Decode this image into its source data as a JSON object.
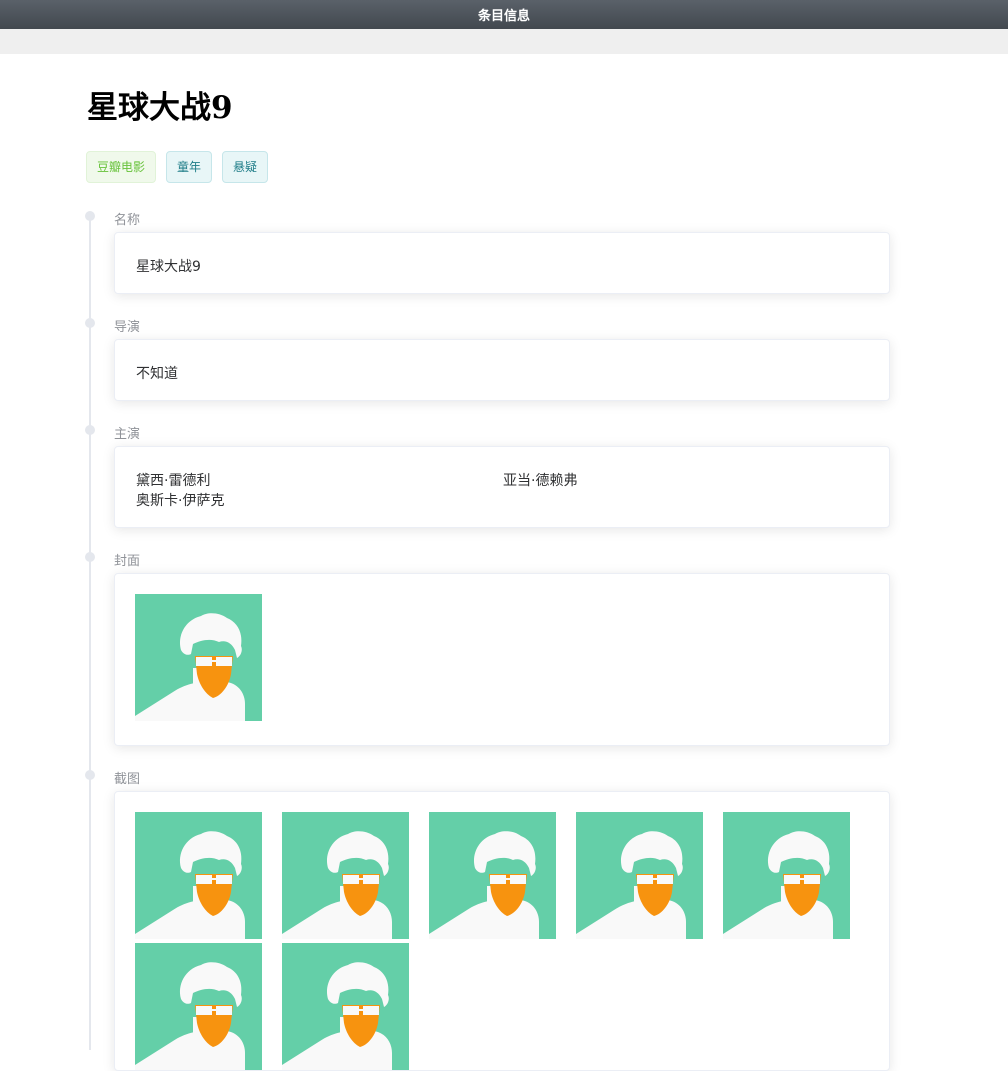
{
  "window": {
    "title": "条目信息"
  },
  "page": {
    "title": "星球大战9"
  },
  "tags": [
    {
      "label": "豆瓣电影",
      "style": "green"
    },
    {
      "label": "童年",
      "style": "teal"
    },
    {
      "label": "悬疑",
      "style": "teal"
    }
  ],
  "timeline": {
    "name": {
      "label": "名称",
      "value": "星球大战9"
    },
    "director": {
      "label": "导演",
      "value": "不知道"
    },
    "cast": {
      "label": "主演",
      "members": [
        "黛西·雷德利",
        "亚当·德赖弗",
        "奥斯卡·伊萨克"
      ]
    },
    "cover": {
      "label": "封面",
      "image_count": 1
    },
    "screenshots": {
      "label": "截图",
      "image_count": 7
    }
  },
  "colors": {
    "avatar_background": "#64cfa8",
    "avatar_face": "#f7930f",
    "avatar_hair": "#f9f9f9",
    "tag_green": "#67c23a",
    "tag_teal": "#1f7d88"
  },
  "icons": {
    "placeholder_image": "avatar-placeholder-icon"
  }
}
